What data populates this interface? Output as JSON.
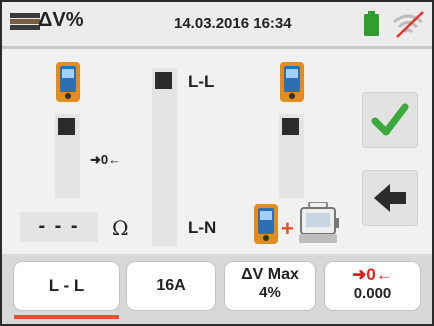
{
  "header": {
    "title": "ΔV%",
    "datetime": "14.03.2016 16:34",
    "title_icon": "measurement-bars-icon",
    "battery_icon": "battery-icon",
    "wifi_icon": "wifi-off-icon"
  },
  "main": {
    "arrow_zero": "➜0←",
    "label_ll": "L-L",
    "label_ln": "L-N",
    "resistance": "- - -",
    "resistance_unit": "Ω",
    "plus": "+",
    "confirm_icon": "checkmark-icon",
    "back_icon": "back-arrow-icon"
  },
  "tabs": [
    {
      "line1": "L - L",
      "line2": ""
    },
    {
      "line1": "16A",
      "line2": ""
    },
    {
      "line1": "ΔV Max",
      "line2": "4%"
    },
    {
      "line1": "➜0←",
      "line2": "0.000"
    }
  ],
  "colors": {
    "accent": "#e2522b",
    "confirm": "#3aa83a",
    "device_orange": "#e38b1f",
    "device_blue": "#2b6fb5",
    "zero_red": "#e0201b"
  }
}
